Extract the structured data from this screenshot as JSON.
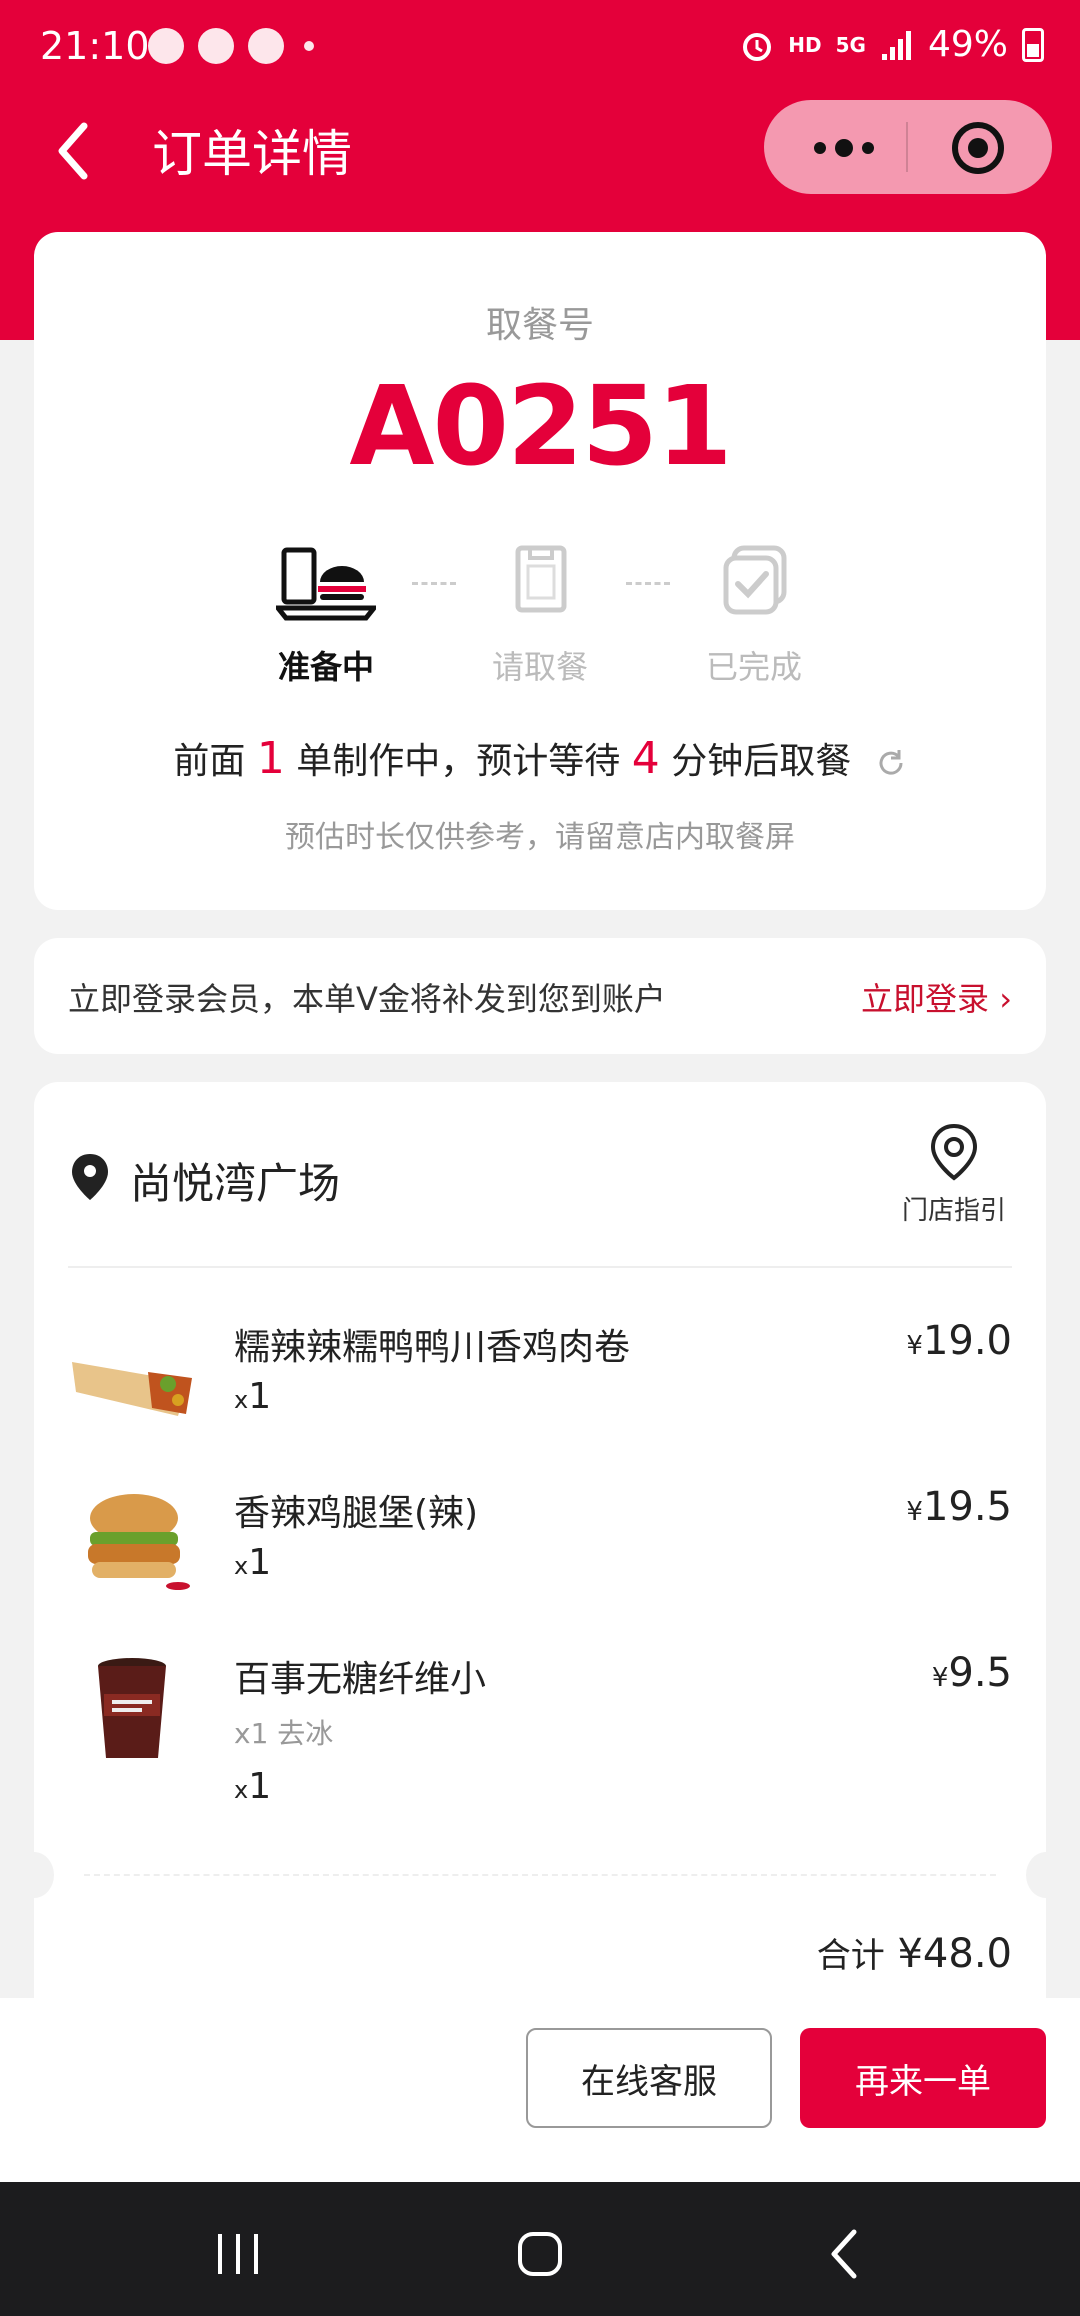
{
  "status_bar": {
    "time": "21:10",
    "hd": "HD",
    "net": "5G",
    "battery": "49%"
  },
  "nav": {
    "title": "订单详情"
  },
  "order": {
    "pickup_label": "取餐号",
    "pickup_number": "A0251",
    "steps": [
      {
        "label": "准备中",
        "active": true
      },
      {
        "label": "请取餐",
        "active": false
      },
      {
        "label": "已完成",
        "active": false
      }
    ],
    "wait_prefix": "前面",
    "orders_ahead": "1",
    "wait_middle": "单制作中，预计等待",
    "wait_minutes": "4",
    "wait_suffix": "分钟后取餐",
    "note": "预估时长仅供参考，请留意店内取餐屏"
  },
  "member": {
    "text": "立即登录会员，本单V金将补发到您到账户",
    "link": "立即登录"
  },
  "store": {
    "name": "尚悦湾广场",
    "guide_label": "门店指引"
  },
  "items": [
    {
      "name": "糯辣辣糯鸭鸭川香鸡肉卷",
      "qty_x": "x",
      "qty": "1",
      "price_sym": "¥",
      "price": "19.0"
    },
    {
      "name": "香辣鸡腿堡(辣)",
      "qty_x": "x",
      "qty": "1",
      "price_sym": "¥",
      "price": "19.5"
    },
    {
      "name": "百事无糖纤维小",
      "option": "x1 去冰",
      "qty_x": "x",
      "qty": "1",
      "price_sym": "¥",
      "price": "9.5"
    }
  ],
  "total": {
    "label": "合计",
    "value": "¥48.0"
  },
  "actions": {
    "service": "在线客服",
    "reorder": "再来一单"
  },
  "colors": {
    "brand_red": "#e4003a",
    "link_red": "#c8102e"
  }
}
